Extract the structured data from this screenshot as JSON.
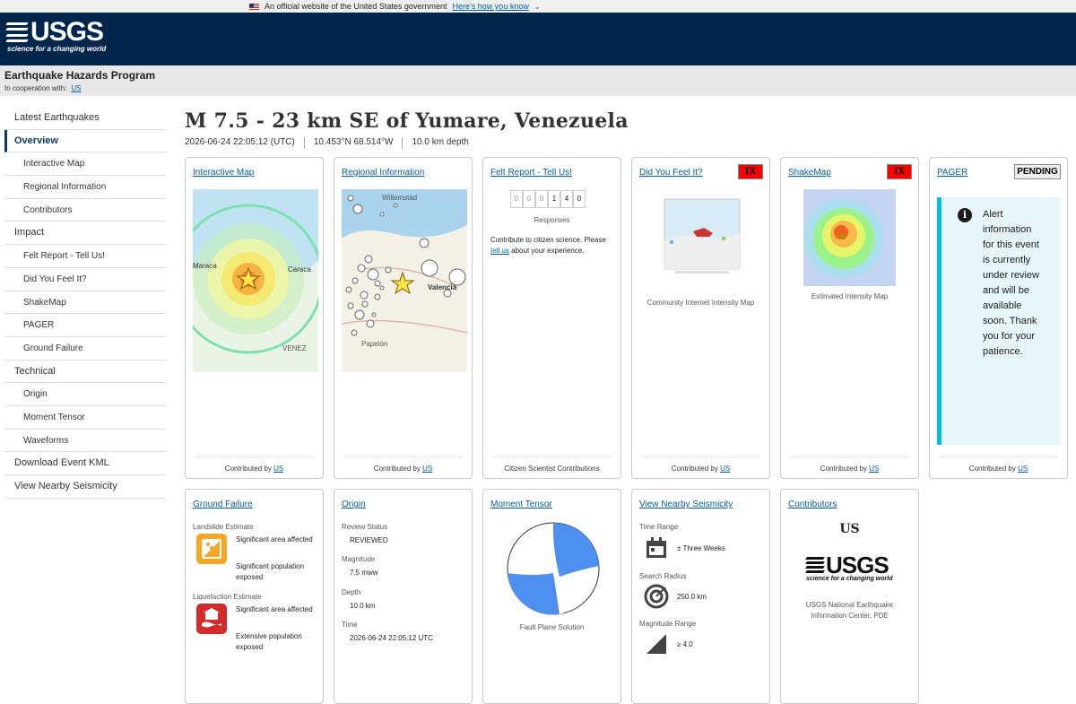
{
  "gov_banner": {
    "text": "An official website of the United States government",
    "link": "Here’s how you know"
  },
  "header": {
    "logo_text": "USGS",
    "logo_tagline": "science for a changing world"
  },
  "subheader": {
    "program": "Earthquake Hazards Program",
    "coop_label": "In cooperation with:",
    "coop_link": "US"
  },
  "sidebar": {
    "items": [
      {
        "label": "Latest Earthquakes"
      },
      {
        "label": "Overview"
      },
      {
        "label": "Interactive Map"
      },
      {
        "label": "Regional Information"
      },
      {
        "label": "Contributors"
      },
      {
        "label": "Impact"
      },
      {
        "label": "Felt Report - Tell Us!"
      },
      {
        "label": "Did You Feel It?"
      },
      {
        "label": "ShakeMap"
      },
      {
        "label": "PAGER"
      },
      {
        "label": "Ground Failure"
      },
      {
        "label": "Technical"
      },
      {
        "label": "Origin"
      },
      {
        "label": "Moment Tensor"
      },
      {
        "label": "Waveforms"
      },
      {
        "label": "Download Event KML"
      },
      {
        "label": "View Nearby Seismicity"
      }
    ]
  },
  "event": {
    "title": "M 7.5 - 23 km SE of Yumare, Venezuela",
    "time": "2026-06-24 22:05:12 (UTC)",
    "location": "10.453°N 68.514°W",
    "depth": "10.0 km depth"
  },
  "cards": {
    "contributed_by": "Contributed by",
    "contributor_link": "US",
    "interactive_map": {
      "title": "Interactive Map",
      "map_labels": [
        "Maraca",
        "Caraca",
        "VENEZ"
      ]
    },
    "regional_info": {
      "title": "Regional Information",
      "map_labels": [
        "Willemstad",
        "Valencia",
        "Papelón"
      ]
    },
    "felt_report": {
      "title": "Felt Report - Tell Us!",
      "digits": [
        "0",
        "0",
        "0",
        "1",
        "4",
        "0"
      ],
      "responses_label": "Responses",
      "text_before": "Contribute to citizen science. Please",
      "link": "tell us",
      "text_after": "about your experience.",
      "footer": "Citizen Scientist Contributions"
    },
    "dyfi": {
      "title": "Did You Feel It?",
      "badge": "IX",
      "caption": "Community Internet Intensity Map"
    },
    "shakemap": {
      "title": "ShakeMap",
      "badge": "IX",
      "caption": "Estimated Intensity Map"
    },
    "pager": {
      "title": "PAGER",
      "badge": "PENDING",
      "message": "Alert information for this event is currently under review and will be available soon. Thank you for your patience."
    },
    "ground_failure": {
      "title": "Ground Failure",
      "landslide_label": "Landslide Estimate",
      "landslide_area": "Significant area affected",
      "landslide_pop": "Significant population exposed",
      "liquefaction_label": "Liquefaction Estimate",
      "liquefaction_area": "Significant area affected",
      "liquefaction_pop": "Extensive population exposed"
    },
    "origin": {
      "title": "Origin",
      "review_label": "Review Status",
      "review_value": "REVIEWED",
      "mag_label": "Magnitude",
      "mag_value": "7.5 mww",
      "depth_label": "Depth",
      "depth_value": "10.0 km",
      "time_label": "Time",
      "time_value": "2026-06-24 22:05:12 UTC"
    },
    "moment_tensor": {
      "title": "Moment Tensor",
      "caption": "Fault Plane Solution"
    },
    "nearby": {
      "title": "View Nearby Seismicity",
      "time_label": "Time Range",
      "time_value": "± Three Weeks",
      "radius_label": "Search Radius",
      "radius_value": "250.0 km",
      "mag_label": "Magnitude Range",
      "mag_value": "≥ 4.0"
    },
    "contributors": {
      "title": "Contributors",
      "code": "US",
      "logo_text": "USGS",
      "logo_tagline": "science for a changing world",
      "name": "USGS National Earthquake Information Center, PDE"
    }
  },
  "colors": {
    "header_bg": "#00264c",
    "link": "#005ea2",
    "badge_ix": "#ff0000",
    "pager_accent": "#00bde3"
  }
}
